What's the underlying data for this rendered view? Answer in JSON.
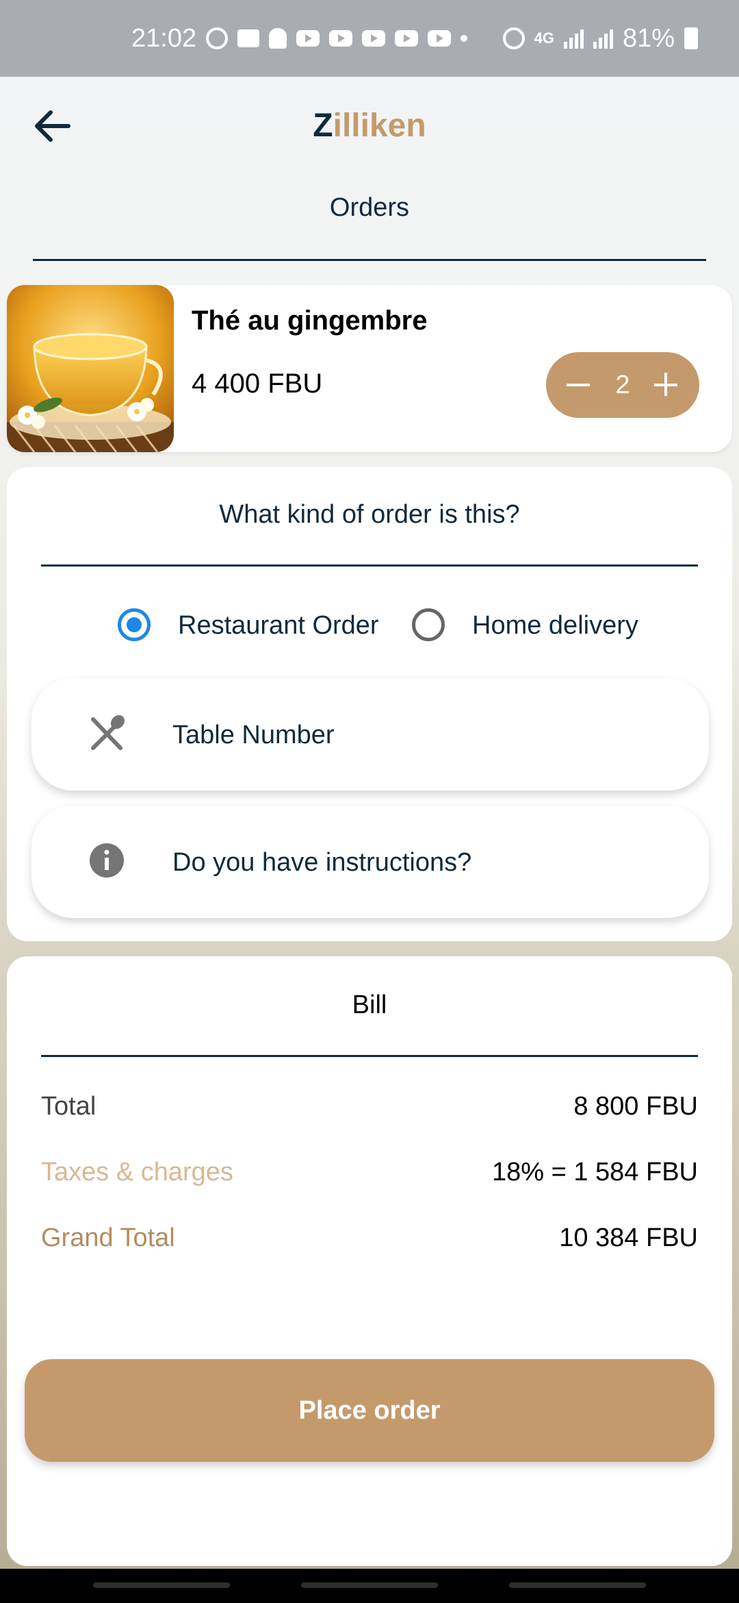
{
  "status_bar": {
    "time": "21:02",
    "network": "4G",
    "battery": "81%"
  },
  "header": {
    "brand_first": "Z",
    "brand_rest": "illiken",
    "section_title": "Orders"
  },
  "cart": {
    "items": [
      {
        "name": "Thé au gingembre",
        "price": "4 400 FBU",
        "quantity": "2"
      }
    ]
  },
  "order_type": {
    "question": "What kind of order is this?",
    "options": [
      {
        "label": "Restaurant Order",
        "selected": true
      },
      {
        "label": "Home delivery",
        "selected": false
      }
    ],
    "table_placeholder": "Table Number",
    "instructions_placeholder": "Do you have instructions?"
  },
  "bill": {
    "title": "Bill",
    "total_label": "Total",
    "total_value": "8 800 FBU",
    "taxes_label": "Taxes & charges",
    "taxes_value": "18% = 1 584 FBU",
    "grand_label": "Grand Total",
    "grand_value": "10 384 FBU"
  },
  "actions": {
    "place_order": "Place order"
  },
  "colors": {
    "accent": "#c49a6c",
    "primary_text": "#0f2a3c",
    "radio_selected": "#1e88e5",
    "taxes_label": "#d7b894"
  }
}
